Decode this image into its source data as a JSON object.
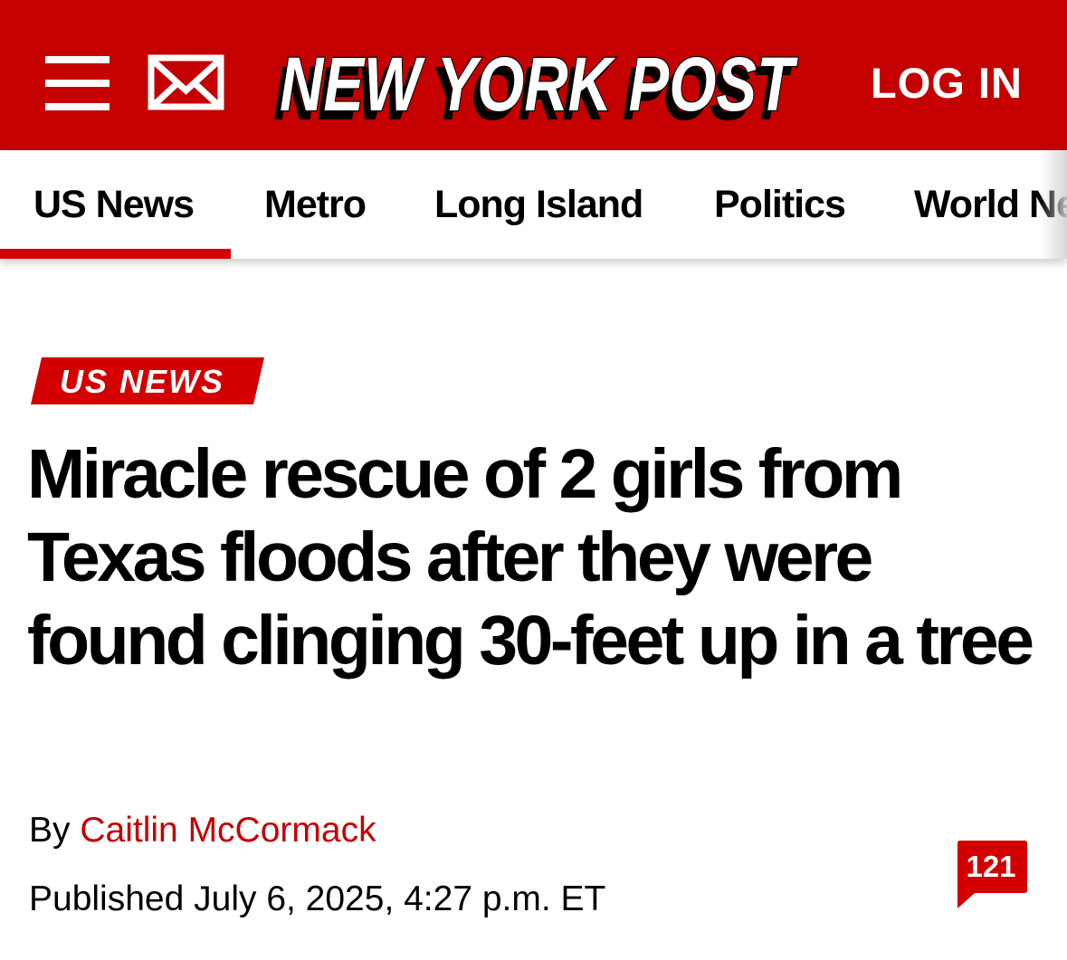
{
  "header": {
    "logo_text": "NEW YORK POST",
    "login_label": "LOG IN",
    "menu_icon": "hamburger-menu-icon",
    "mail_icon": "envelope-icon"
  },
  "nav": {
    "items": [
      {
        "label": "US News",
        "active": true
      },
      {
        "label": "Metro"
      },
      {
        "label": "Long Island"
      },
      {
        "label": "Politics"
      },
      {
        "label": "World News"
      }
    ]
  },
  "article": {
    "section": "US NEWS",
    "headline": "Miracle rescue of 2 girls from Texas floods after they were found clinging 30-feet up in a tree",
    "byline_prefix": "By ",
    "author": "Caitlin McCormack",
    "published": "Published July 6, 2025, 4:27 p.m. ET",
    "comment_count": "121"
  },
  "colors": {
    "brand_red": "#c50000",
    "text": "#000000",
    "background": "#ffffff"
  }
}
